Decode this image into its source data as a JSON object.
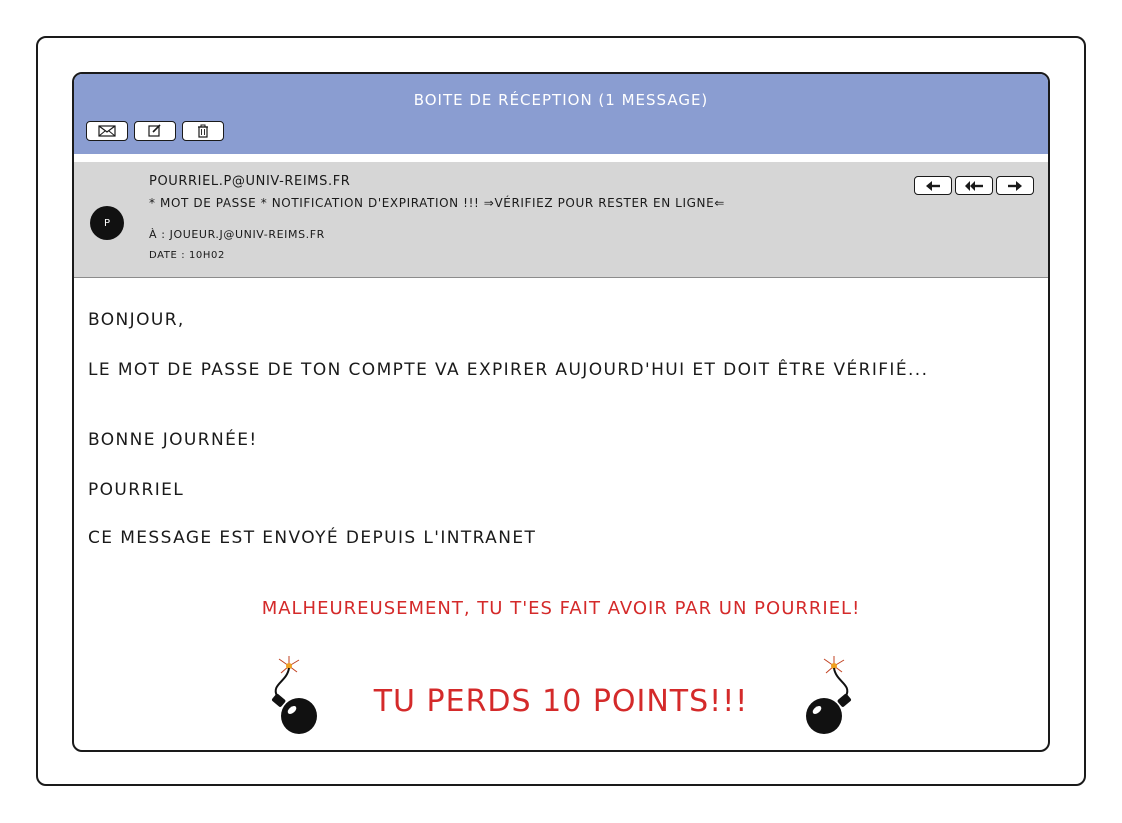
{
  "window": {
    "title": "BOITE DE RÉCEPTION  (1 MESSAGE)"
  },
  "toolbar": [
    {
      "name": "inbox",
      "icon": "envelope-icon"
    },
    {
      "name": "compose",
      "icon": "compose-icon"
    },
    {
      "name": "delete",
      "icon": "trash-icon"
    }
  ],
  "email": {
    "avatar_letter": "P",
    "from": "POURRIEL.P@UNIV-REIMS.FR",
    "subject": "* MOT DE PASSE * NOTIFICATION D'EXPIRATION !!! ⇒VÉRIFIEZ POUR RESTER EN LIGNE⇐",
    "to": "À : JOUEUR.J@UNIV-REIMS.FR",
    "date": "DATE : 10H02",
    "actions": [
      {
        "name": "reply",
        "icon": "reply-icon"
      },
      {
        "name": "reply-all",
        "icon": "reply-all-icon"
      },
      {
        "name": "forward",
        "icon": "forward-icon"
      }
    ],
    "body": {
      "greeting": "BONJOUR,",
      "paragraph": "LE MOT DE PASSE DE TON COMPTE VA EXPIRER AUJOURD'HUI ET DOIT ÊTRE VÉRIFIÉ...",
      "closing": "BONNE JOURNÉE!",
      "signature": "POURRIEL",
      "footer": "CE MESSAGE EST ENVOYÉ DEPUIS L'INTRANET"
    }
  },
  "result": {
    "message": "MALHEUREUSEMENT, TU T'ES FAIT AVOIR PAR UN POURRIEL!",
    "penalty": "TU PERDS 10 POINTS!!!",
    "color": "#d42a2a"
  },
  "colors": {
    "titlebar": "#8a9dd1",
    "header": "#d6d6d6"
  }
}
